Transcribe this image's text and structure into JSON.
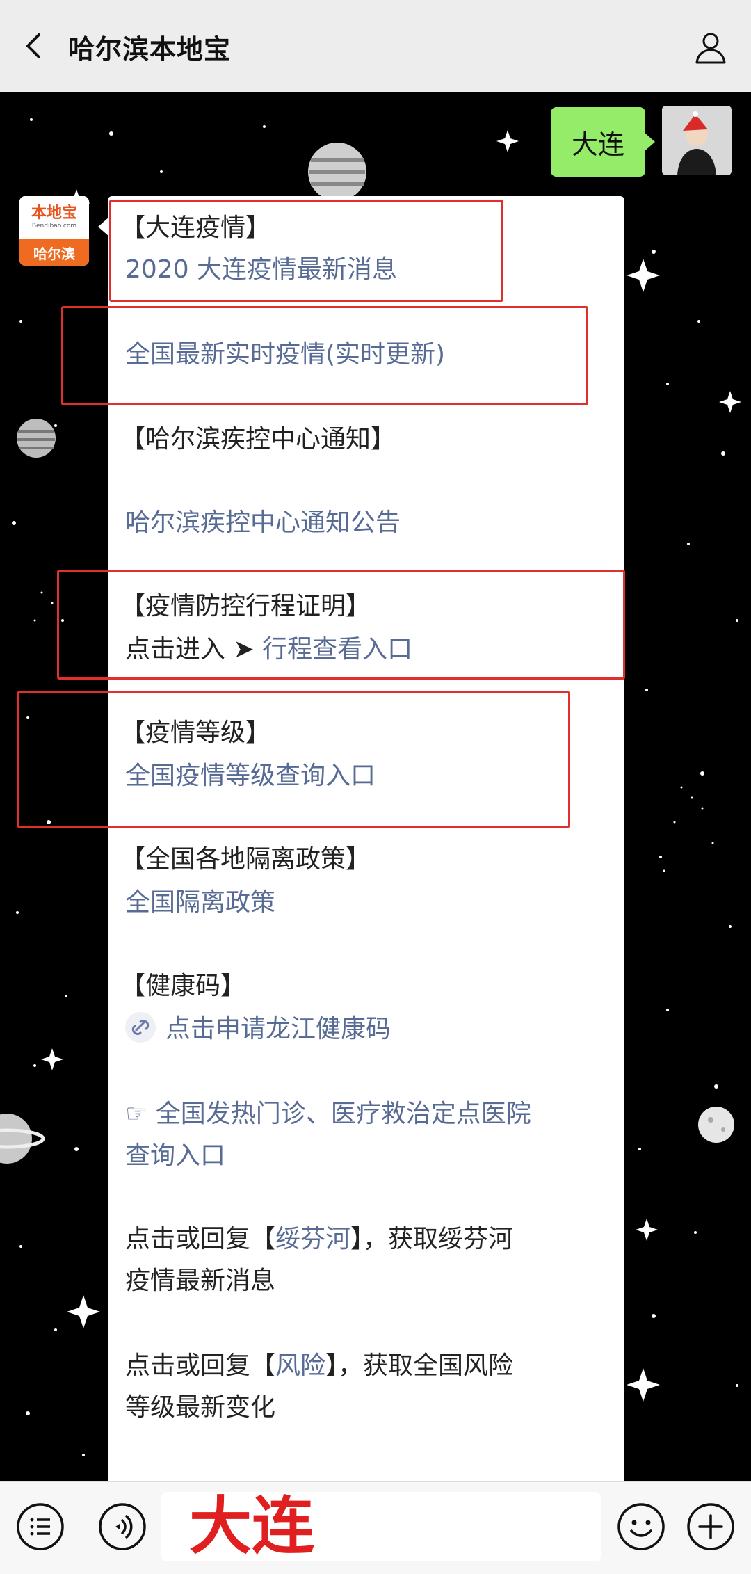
{
  "header": {
    "title": "哈尔滨本地宝"
  },
  "self_message": {
    "text": "大连"
  },
  "bot_avatar": {
    "brand": "本地宝",
    "domain": "Bendibao.com",
    "city": "哈尔滨"
  },
  "card": {
    "sections": [
      {
        "title": "【大连疫情】",
        "link": "2020 大连疫情最新消息"
      },
      {
        "link": "全国最新实时疫情(实时更新)"
      },
      {
        "title": "【哈尔滨疾控中心通知】",
        "link": "哈尔滨疾控中心通知公告"
      },
      {
        "title": "【疫情防控行程证明】",
        "prefix": "点击进入 ➤ ",
        "link": "行程查看入口"
      },
      {
        "title": "【疫情等级】",
        "link": "全国疫情等级查询入口"
      },
      {
        "title": "【全国各地隔离政策】",
        "link": "全国隔离政策"
      },
      {
        "title": "【健康码】",
        "link": "点击申请龙江健康码"
      },
      {
        "link_line1": "☞ 全国发热门诊、医疗救治定点医院",
        "link_line2": "查询入口"
      },
      {
        "pre": "点击或回复【",
        "kw": "绥芬河",
        "post": "】，获取绥芬河",
        "line2": "疫情最新消息"
      },
      {
        "pre": "点击或回复【",
        "kw": "风险",
        "post": "】，获取全国风险",
        "line2": "等级最新变化"
      }
    ]
  },
  "input": {
    "value": "大连"
  },
  "icons": [
    "back-icon",
    "user-icon",
    "menu-icon",
    "voice-icon",
    "emoji-icon",
    "plus-icon",
    "link-chain-icon"
  ]
}
